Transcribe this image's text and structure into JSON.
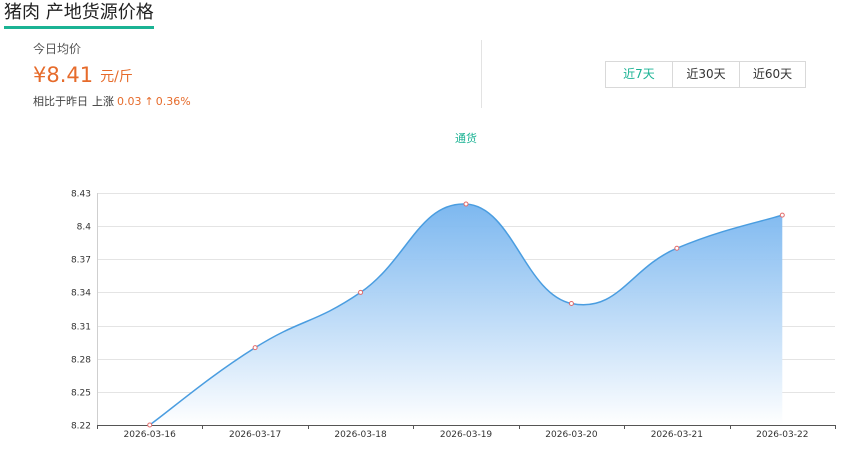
{
  "title": "猪肉 产地货源价格",
  "summary": {
    "label": "今日均价",
    "price": "¥8.41",
    "unit": "元/斤",
    "compare_prefix": "相比于昨日",
    "direction": "上涨",
    "change_amount": "0.03",
    "arrow": "↑",
    "change_percent": "0.36%"
  },
  "range_buttons": [
    {
      "label": "近7天",
      "active": true
    },
    {
      "label": "近30天",
      "active": false
    },
    {
      "label": "近60天",
      "active": false
    }
  ],
  "colors": {
    "accent": "#1bb394",
    "price": "#e66b2b",
    "line": "#4a9de0",
    "area_top": "#76b4ef",
    "area_bottom": "#ffffff",
    "point": "#e26b6b"
  },
  "chart_data": {
    "type": "area",
    "x": [
      "2026-03-16",
      "2026-03-17",
      "2026-03-18",
      "2026-03-19",
      "2026-03-20",
      "2026-03-21",
      "2026-03-22"
    ],
    "series": [
      {
        "name": "通货",
        "values": [
          8.22,
          8.29,
          8.34,
          8.42,
          8.33,
          8.38,
          8.41
        ]
      }
    ],
    "yticks": [
      "8.22",
      "8.25",
      "8.28",
      "8.31",
      "8.34",
      "8.37",
      "8.4",
      "8.43"
    ],
    "ylim": [
      8.22,
      8.43
    ],
    "smooth": true,
    "grid": true,
    "legend": "top-center"
  }
}
